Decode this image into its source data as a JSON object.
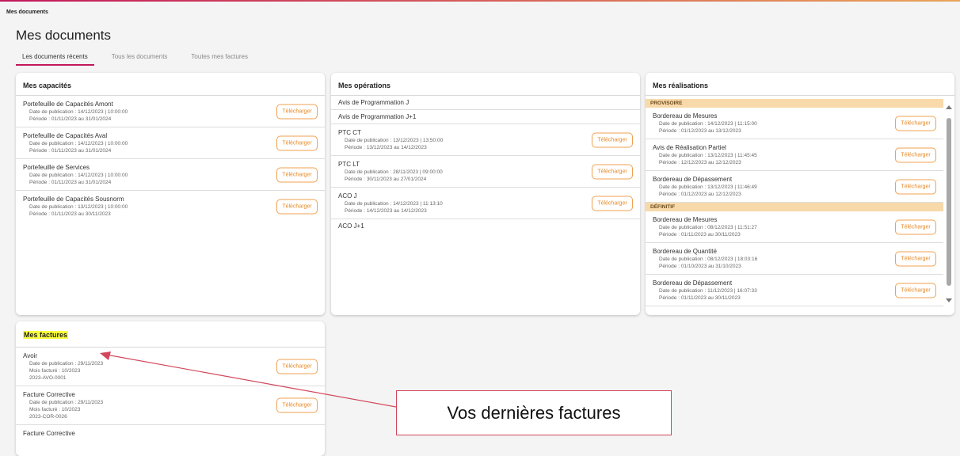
{
  "breadcrumb": "Mes documents",
  "page_title": "Mes documents",
  "tabs": [
    {
      "label": "Les documents récents",
      "active": true
    },
    {
      "label": "Tous les documents",
      "active": false
    },
    {
      "label": "Toutes mes factures",
      "active": false
    }
  ],
  "button_label": "Télécharger",
  "capacites": {
    "title": "Mes capacités",
    "items": [
      {
        "title": "Portefeuille de Capacités Amont",
        "date": "Date de publication : 14/12/2023 | 10:00:00",
        "period": "Période : 01/11/2023 au 31/01/2024"
      },
      {
        "title": "Portefeuille de Capacités Aval",
        "date": "Date de publication : 14/12/2023 | 10:00:00",
        "period": "Période : 01/11/2023 au 31/01/2024"
      },
      {
        "title": "Portefeuille de Services",
        "date": "Date de publication : 14/12/2023 | 10:00:00",
        "period": "Période : 01/11/2023 au 31/01/2024"
      },
      {
        "title": "Portefeuille de Capacités Sousnorm",
        "date": "Date de publication : 13/12/2023 | 10:00:00",
        "period": "Période : 01/11/2023 au 30/11/2023"
      }
    ]
  },
  "operations": {
    "title": "Mes opérations",
    "items": [
      {
        "title": "Avis de Programmation J"
      },
      {
        "title": "Avis de Programmation J+1"
      },
      {
        "title": "PTC CT",
        "date": "Date de publication : 13/12/2023 | 13:50:00",
        "period": "Période : 13/12/2023 au 14/12/2023"
      },
      {
        "title": "PTC LT",
        "date": "Date de publication : 28/11/2023 | 09:00:00",
        "period": "Période : 30/11/2023 au 27/01/2024"
      },
      {
        "title": "ACO J",
        "date": "Date de publication : 14/12/2023 | 11:13:10",
        "period": "Période : 14/12/2023 au 14/12/2023"
      },
      {
        "title": "ACO J+1"
      }
    ]
  },
  "realisations": {
    "title": "Mes réalisations",
    "provisoire_label": "PROVISOIRE",
    "definitif_label": "DÉFINITIF",
    "provisoire": [
      {
        "title": "Bordereau de Mesures",
        "date": "Date de publication : 14/12/2023 | 11:15:00",
        "period": "Période : 01/12/2023 au 13/12/2023"
      },
      {
        "title": "Avis de Réalisation Partiel",
        "date": "Date de publication : 13/12/2023 | 11:45:45",
        "period": "Période : 12/12/2023 au 12/12/2023"
      },
      {
        "title": "Bordereau de Dépassement",
        "date": "Date de publication : 13/12/2023 | 11:46:49",
        "period": "Période : 01/12/2023 au 12/12/2023"
      }
    ],
    "definitif": [
      {
        "title": "Bordereau de Mesures",
        "date": "Date de publication : 08/12/2023 | 11:51:27",
        "period": "Période : 01/11/2023 au 30/11/2023"
      },
      {
        "title": "Bordereau de Quantité",
        "date": "Date de publication : 08/12/2023 | 18:03:16",
        "period": "Période : 01/10/2023 au 31/10/2023"
      },
      {
        "title": "Bordereau de Dépassement",
        "date": "Date de publication : 11/12/2023 | 16:07:33",
        "period": "Période : 01/11/2023 au 30/11/2023"
      }
    ]
  },
  "factures": {
    "title": "Mes factures",
    "items": [
      {
        "title": "Avoir",
        "date": "Date de publication : 29/11/2023",
        "month": "Mois facturé : 10/2023",
        "ref": "2023-AVO-0001"
      },
      {
        "title": "Facture Corrective",
        "date": "Date de publication : 29/11/2023",
        "month": "Mois facturé : 10/2023",
        "ref": "2023-COR-0026"
      },
      {
        "title": "Facture Corrective"
      }
    ]
  },
  "callout_text": "Vos dernières factures",
  "colors": {
    "accent": "#c2185b",
    "button": "#f0a050",
    "section": "#f8d9aa",
    "highlight": "#fbff3b",
    "callout_border": "#d2475c"
  }
}
